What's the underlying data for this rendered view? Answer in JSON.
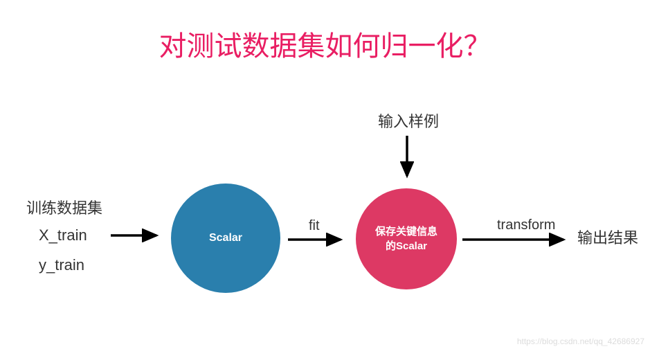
{
  "title": "对测试数据集如何归一化？",
  "labels": {
    "input_sample": "输入样例",
    "train_title": "训练数据集",
    "x_train": "X_train",
    "y_train": "y_train",
    "fit": "fit",
    "transform": "transform",
    "output": "输出结果"
  },
  "nodes": {
    "scalar": "Scalar",
    "scalar_with_info": "保存关键信息\n的Scalar"
  },
  "colors": {
    "title": "#e91e63",
    "blue_node": "#2a7fad",
    "red_node": "#dd3964"
  },
  "watermark": "https://blog.csdn.net/qq_42686927"
}
